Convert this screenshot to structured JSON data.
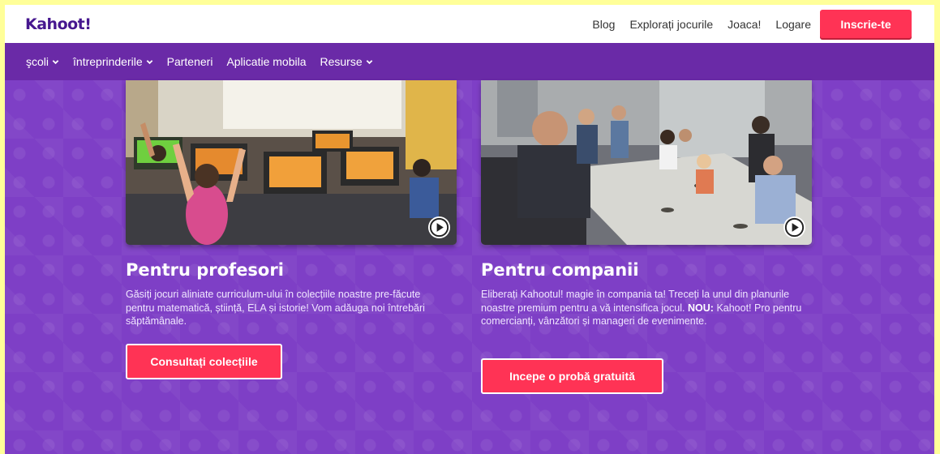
{
  "header": {
    "logo": "Kahoot!",
    "links": [
      "Blog",
      "Explorați jocurile",
      "Joaca!",
      "Logare"
    ],
    "signup_label": "Inscrie-te"
  },
  "nav": {
    "items": [
      {
        "label": "şcoli",
        "dropdown": true
      },
      {
        "label": "întreprinderile",
        "dropdown": true
      },
      {
        "label": "Parteneri",
        "dropdown": false
      },
      {
        "label": "Aplicatie mobila",
        "dropdown": false
      },
      {
        "label": "Resurse",
        "dropdown": true
      }
    ]
  },
  "cards": {
    "teachers": {
      "title": "Pentru profesori",
      "text": "Găsiți jocuri aliniate curriculum-ului în colecțiile noastre pre-făcute pentru matematică, știință, ELA și istorie! Vom adăuga noi întrebări săptămânale.",
      "button": "Consultați colecțiile"
    },
    "companies": {
      "title": "Pentru companii",
      "text_before": "Eliberați Kahootul! magie în compania ta! Treceți la unul din planurile noastre premium pentru a vă intensifica jocul.",
      "text_bold": "NOU:",
      "text_after": "Kahoot! Pro pentru comercianți, vânzători și manageri de evenimente.",
      "button": "Incepe o probă gratuită"
    }
  },
  "colors": {
    "accent": "#ff3355",
    "nav_bg": "#6a2aa7",
    "hero_bg": "#7e3fc6",
    "brand": "#46178f"
  }
}
